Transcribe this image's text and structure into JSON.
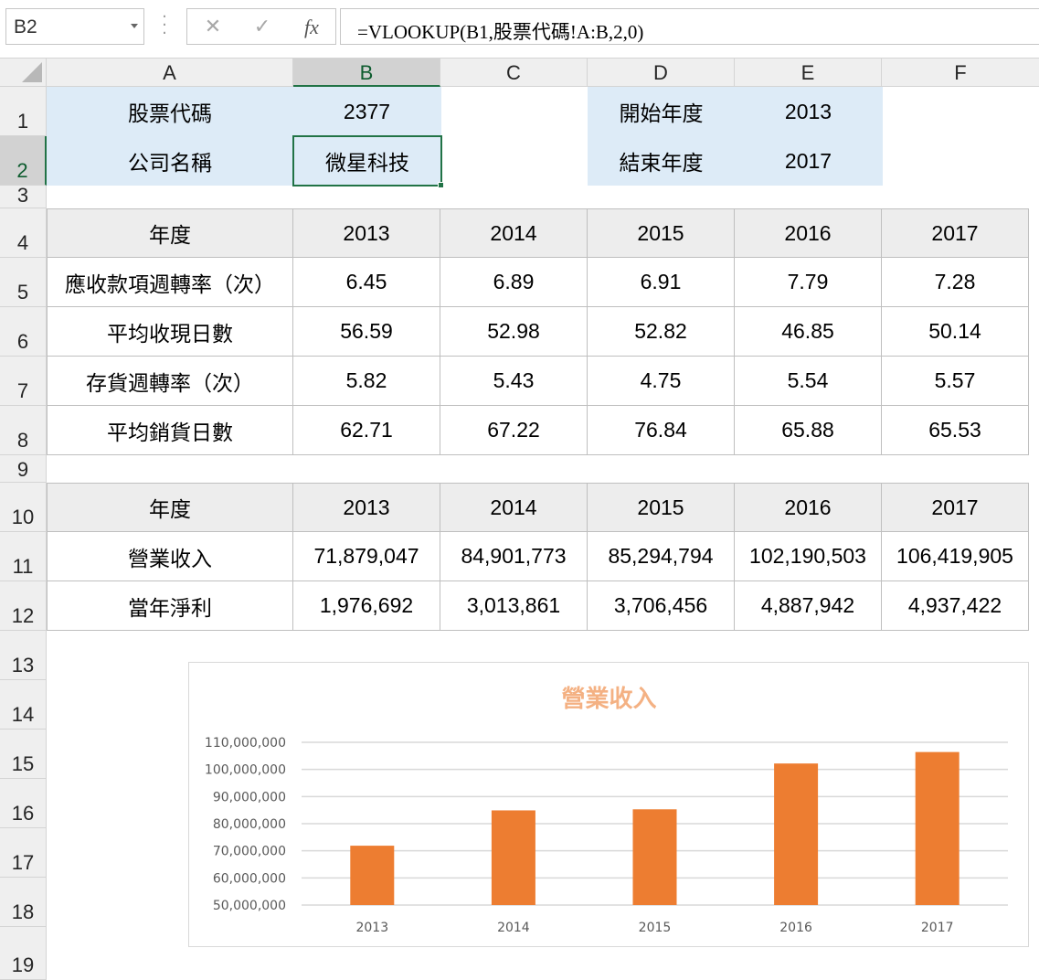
{
  "name_box": "B2",
  "formula": "=VLOOKUP(B1,股票代碼!A:B,2,0)",
  "formula_buttons": {
    "cancel": "✕",
    "enter": "✓",
    "fx": "fx"
  },
  "columns": [
    "A",
    "B",
    "C",
    "D",
    "E",
    "F"
  ],
  "rows": [
    "1",
    "2",
    "3",
    "4",
    "5",
    "6",
    "7",
    "8",
    "9",
    "10",
    "11",
    "12",
    "13",
    "14",
    "15",
    "16",
    "17",
    "18",
    "19"
  ],
  "info": {
    "stock_code_label": "股票代碼",
    "stock_code": "2377",
    "company_label": "公司名稱",
    "company": "微星科技",
    "start_label": "開始年度",
    "start_year": "2013",
    "end_label": "結束年度",
    "end_year": "2017"
  },
  "table1": {
    "header": [
      "年度",
      "2013",
      "2014",
      "2015",
      "2016",
      "2017"
    ],
    "rows": [
      [
        "應收款項週轉率（次）",
        "6.45",
        "6.89",
        "6.91",
        "7.79",
        "7.28"
      ],
      [
        "平均收現日數",
        "56.59",
        "52.98",
        "52.82",
        "46.85",
        "50.14"
      ],
      [
        "存貨週轉率（次）",
        "5.82",
        "5.43",
        "4.75",
        "5.54",
        "5.57"
      ],
      [
        "平均銷貨日數",
        "62.71",
        "67.22",
        "76.84",
        "65.88",
        "65.53"
      ]
    ]
  },
  "table2": {
    "header": [
      "年度",
      "2013",
      "2014",
      "2015",
      "2016",
      "2017"
    ],
    "rows": [
      [
        "營業收入",
        "71,879,047",
        "84,901,773",
        "85,294,794",
        "102,190,503",
        "106,419,905"
      ],
      [
        "當年淨利",
        "1,976,692",
        "3,013,861",
        "3,706,456",
        "4,887,942",
        "4,937,422"
      ]
    ]
  },
  "chart_data": {
    "type": "bar",
    "title": "營業收入",
    "categories": [
      "2013",
      "2014",
      "2015",
      "2016",
      "2017"
    ],
    "values": [
      71879047,
      84901773,
      85294794,
      102190503,
      106419905
    ],
    "ylim": [
      50000000,
      110000000
    ],
    "yticks": [
      "50,000,000",
      "60,000,000",
      "70,000,000",
      "80,000,000",
      "90,000,000",
      "100,000,000",
      "110,000,000"
    ],
    "xlabel": "",
    "ylabel": "",
    "grid": true,
    "legend": "none",
    "bar_color": "#ed7d31",
    "title_color": "#f4b183",
    "grid_color": "#d9d9d9"
  }
}
